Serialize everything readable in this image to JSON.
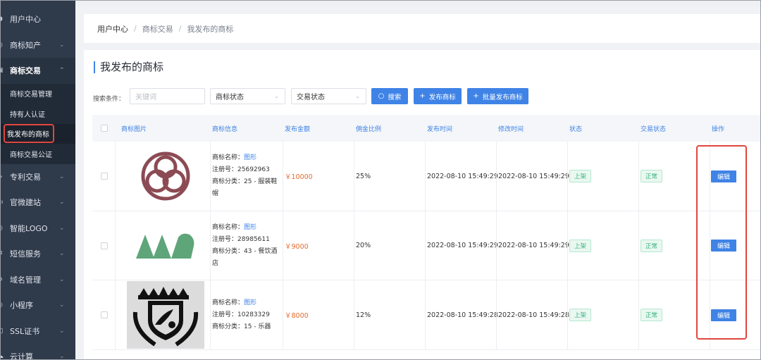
{
  "sidebar": {
    "items": [
      {
        "label": "用户中心",
        "icon": "user-icon",
        "chevron": false
      },
      {
        "label": "商标知产",
        "icon": "circle-icon",
        "chevron": true
      },
      {
        "label": "商标交易",
        "icon": "trade-icon",
        "chevron": true,
        "open": true
      },
      {
        "label": "专利交易",
        "icon": "patent-icon",
        "chevron": true
      },
      {
        "label": "官微建站",
        "icon": "monitor-icon",
        "chevron": true
      },
      {
        "label": "智能LOGO",
        "icon": "circle-icon",
        "chevron": true
      },
      {
        "label": "短信服务",
        "icon": "message-icon",
        "chevron": true
      },
      {
        "label": "域名管理",
        "icon": "globe-icon",
        "chevron": true
      },
      {
        "label": "小程序",
        "icon": "circle-icon",
        "chevron": true
      },
      {
        "label": "SSL证书",
        "icon": "lock-icon",
        "chevron": true
      },
      {
        "label": "云计算",
        "icon": "cloud-icon",
        "chevron": true
      }
    ],
    "submenu": [
      {
        "label": "商标交易管理"
      },
      {
        "label": "持有人认证"
      },
      {
        "label": "我发布的商标",
        "active": true
      },
      {
        "label": "商标交易公证"
      }
    ]
  },
  "breadcrumb": [
    "用户中心",
    "商标交易",
    "我发布的商标"
  ],
  "page_title": "我发布的商标",
  "search": {
    "label": "搜索条件：",
    "keyword_placeholder": "关键词",
    "status_select": "商标状态",
    "trade_select": "交易状态",
    "search_btn": "搜索",
    "publish_btn": "发布商标",
    "batch_btn": "批量发布商标"
  },
  "table": {
    "headers": [
      "商标图片",
      "商标信息",
      "发布金额",
      "佣金比例",
      "发布时间",
      "修改时间",
      "状态",
      "交易状态",
      "操作"
    ],
    "rows": [
      {
        "name_label": "商标名称：",
        "name": "图形",
        "reg_label": "注册号：",
        "reg": "25692963",
        "cat_label": "商标分类：",
        "cat": "25 - 服装鞋帽",
        "price": "￥10000",
        "commission": "25%",
        "published": "2022-08-10 15:49:29",
        "modified": "2022-08-10 15:49:29",
        "status": "上架",
        "trade_status": "正常",
        "action": "编辑"
      },
      {
        "name_label": "商标名称：",
        "name": "图形",
        "reg_label": "注册号：",
        "reg": "28985611",
        "cat_label": "商标分类：",
        "cat": "43 - 餐饮酒店",
        "price": "￥9000",
        "commission": "20%",
        "published": "2022-08-10 15:49:29",
        "modified": "2022-08-10 15:49:29",
        "status": "上架",
        "trade_status": "正常",
        "action": "编辑"
      },
      {
        "name_label": "商标名称：",
        "name": "图形",
        "reg_label": "注册号：",
        "reg": "10283329",
        "cat_label": "商标分类：",
        "cat": "15 - 乐器",
        "price": "￥8000",
        "commission": "12%",
        "published": "2022-08-10 15:49:28",
        "modified": "2022-08-10 15:49:28",
        "status": "上架",
        "trade_status": "正常",
        "action": "编辑"
      }
    ]
  },
  "colors": {
    "accent": "#3f83e6",
    "sidebar": "#2f3a4b",
    "price": "#e56b2e",
    "tag_green": "#36b37e",
    "highlight": "#e0463e"
  }
}
